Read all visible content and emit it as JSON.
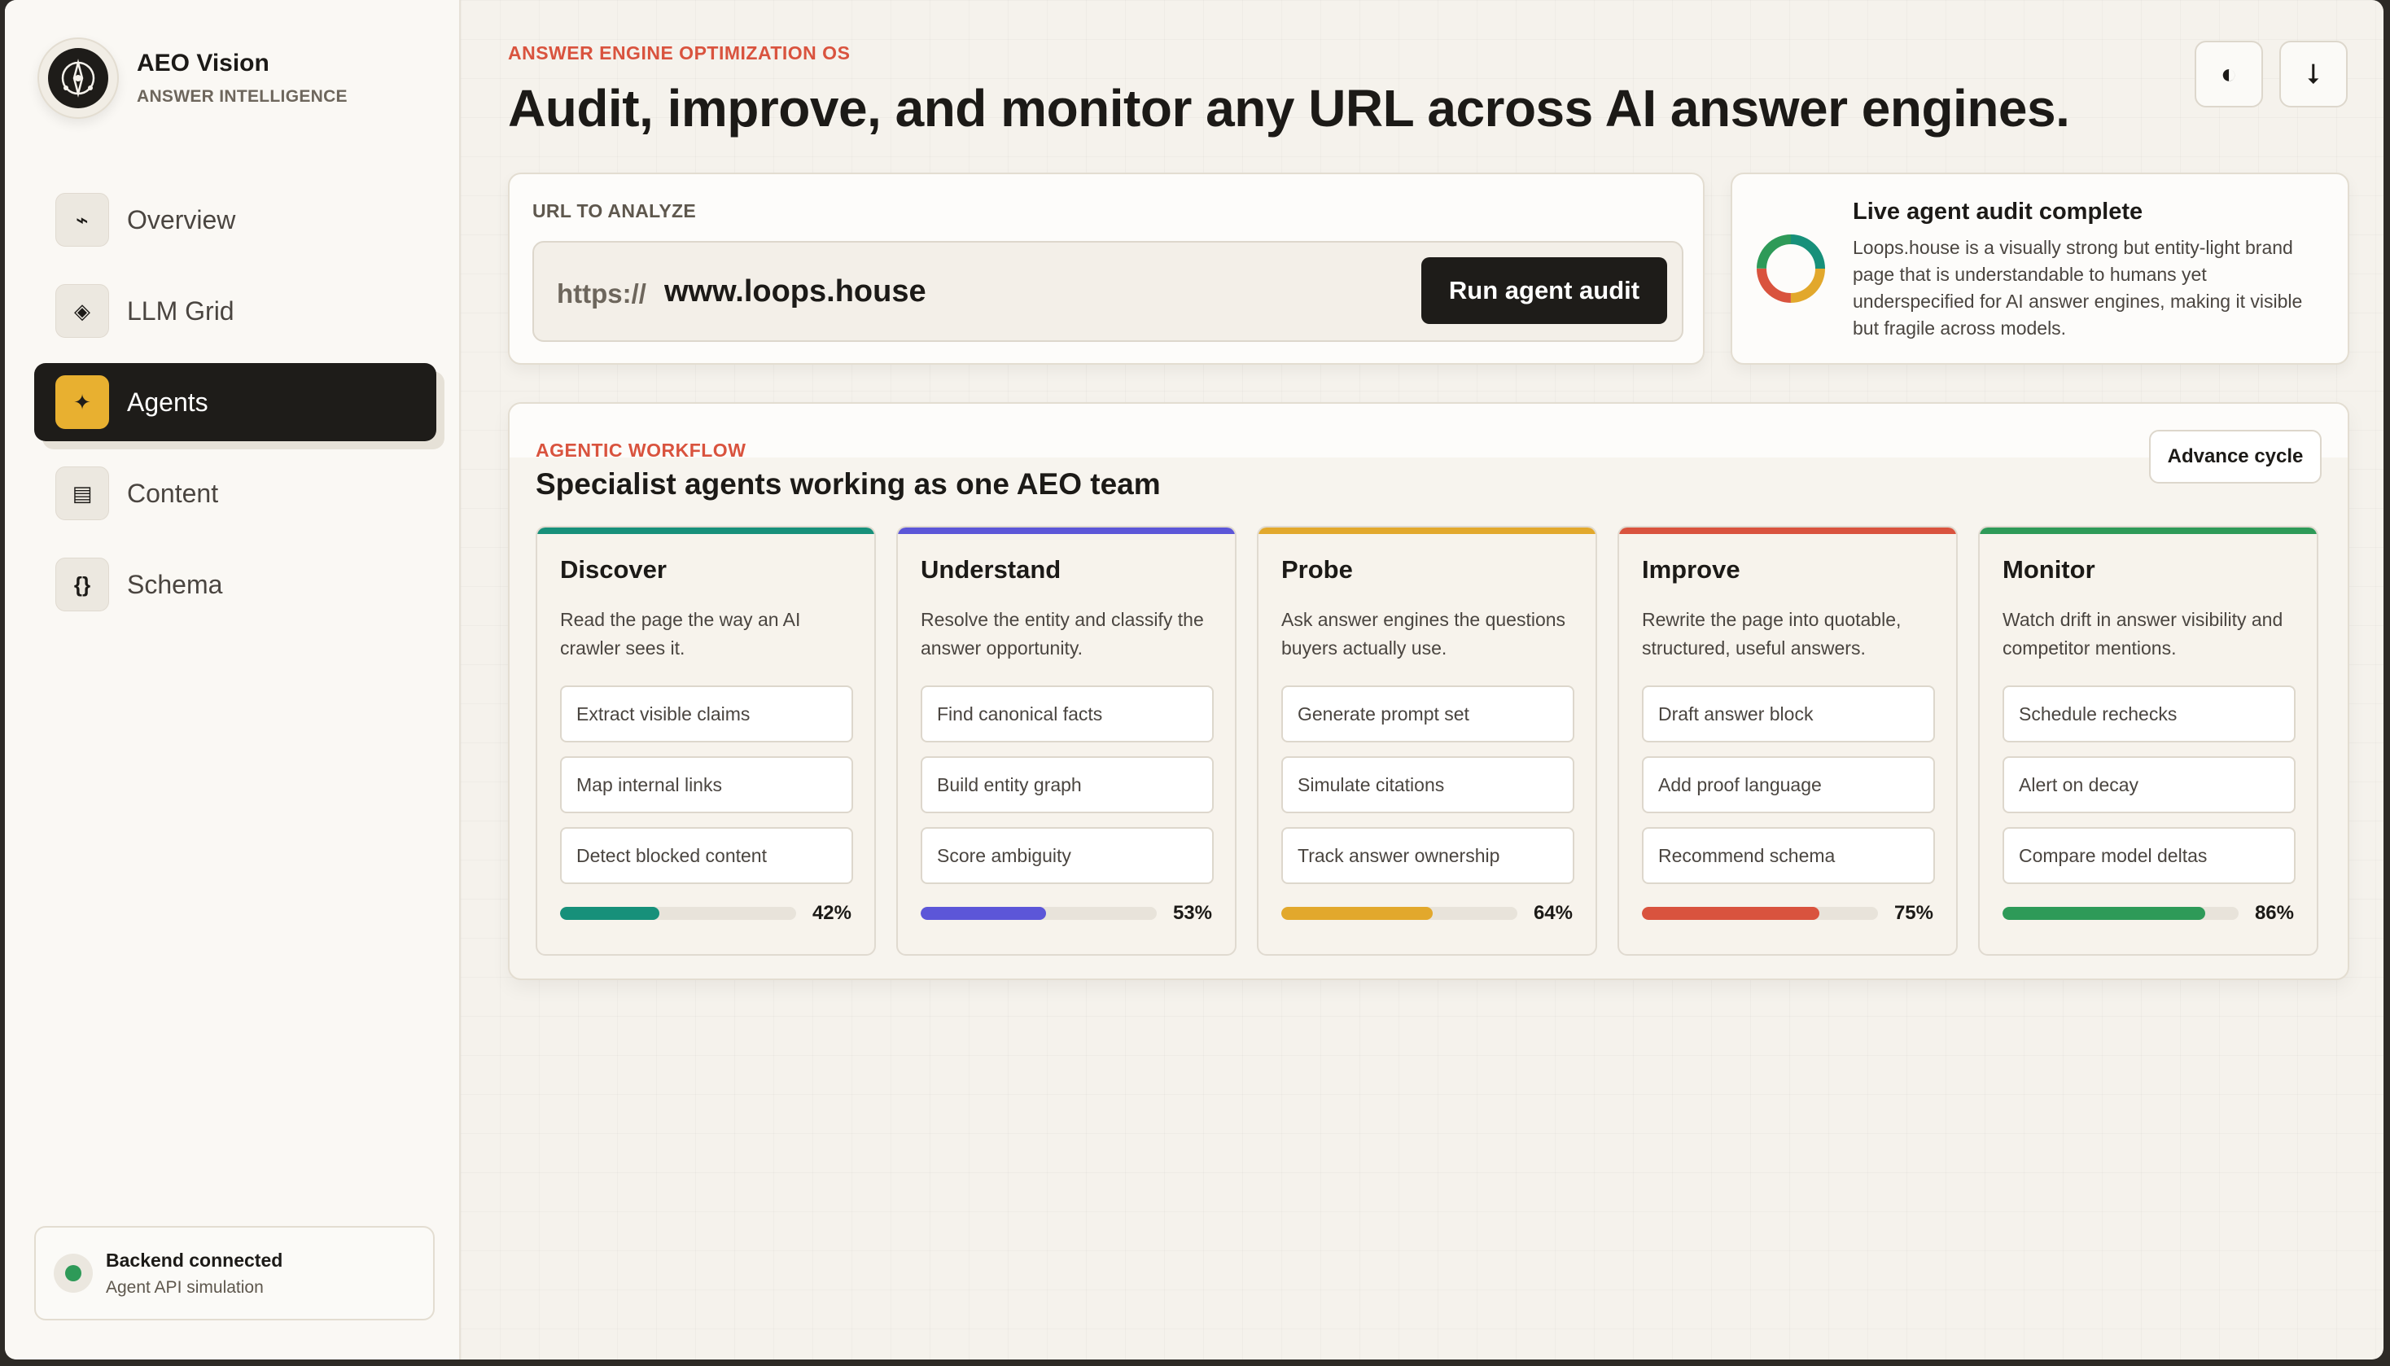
{
  "brand": {
    "name": "AEO Vision",
    "subtitle": "ANSWER INTELLIGENCE"
  },
  "nav": [
    {
      "label": "Overview",
      "icon": "⌁",
      "icon_name": "pulse-icon",
      "active": false
    },
    {
      "label": "LLM Grid",
      "icon": "◈",
      "icon_name": "diamond-icon",
      "active": false
    },
    {
      "label": "Agents",
      "icon": "✦",
      "icon_name": "sparkle-icon",
      "active": true
    },
    {
      "label": "Content",
      "icon": "▤",
      "icon_name": "document-icon",
      "active": false
    },
    {
      "label": "Schema",
      "icon": "{}",
      "icon_name": "braces-icon",
      "active": false
    }
  ],
  "backend": {
    "title": "Backend connected",
    "subtitle": "Agent API simulation",
    "status_color": "#2e9a58"
  },
  "header": {
    "eyebrow": "ANSWER ENGINE OPTIMIZATION OS",
    "title": "Audit, improve, and monitor any URL across AI answer engines.",
    "theme_icon": "◐",
    "download_icon": "⭣"
  },
  "url_card": {
    "label": "URL TO ANALYZE",
    "prefix": "https://",
    "value": "www.loops.house",
    "run_label": "Run agent audit"
  },
  "audit": {
    "title": "Live agent audit complete",
    "body": "Loops.house is a visually strong but entity-light brand page that is understandable to humans yet underspecified for AI answer engines, making it visible but fragile across models."
  },
  "workflow": {
    "eyebrow": "AGENTIC WORKFLOW",
    "title": "Specialist agents working as one AEO team",
    "advance_label": "Advance cycle",
    "agents": [
      {
        "name": "Discover",
        "description": "Read the page the way an AI crawler sees it.",
        "tasks": [
          "Extract visible claims",
          "Map internal links",
          "Detect blocked content"
        ],
        "progress": 42,
        "progress_label": "42%",
        "color": "#17907a"
      },
      {
        "name": "Understand",
        "description": "Resolve the entity and classify the answer opportunity.",
        "tasks": [
          "Find canonical facts",
          "Build entity graph",
          "Score ambiguity"
        ],
        "progress": 53,
        "progress_label": "53%",
        "color": "#5c56d8"
      },
      {
        "name": "Probe",
        "description": "Ask answer engines the questions buyers actually use.",
        "tasks": [
          "Generate prompt set",
          "Simulate citations",
          "Track answer ownership"
        ],
        "progress": 64,
        "progress_label": "64%",
        "color": "#e2a82c"
      },
      {
        "name": "Improve",
        "description": "Rewrite the page into quotable, structured, useful answers.",
        "tasks": [
          "Draft answer block",
          "Add proof language",
          "Recommend schema"
        ],
        "progress": 75,
        "progress_label": "75%",
        "color": "#d9533e"
      },
      {
        "name": "Monitor",
        "description": "Watch drift in answer visibility and competitor mentions.",
        "tasks": [
          "Schedule rechecks",
          "Alert on decay",
          "Compare model deltas"
        ],
        "progress": 86,
        "progress_label": "86%",
        "color": "#2e9a58"
      }
    ]
  }
}
